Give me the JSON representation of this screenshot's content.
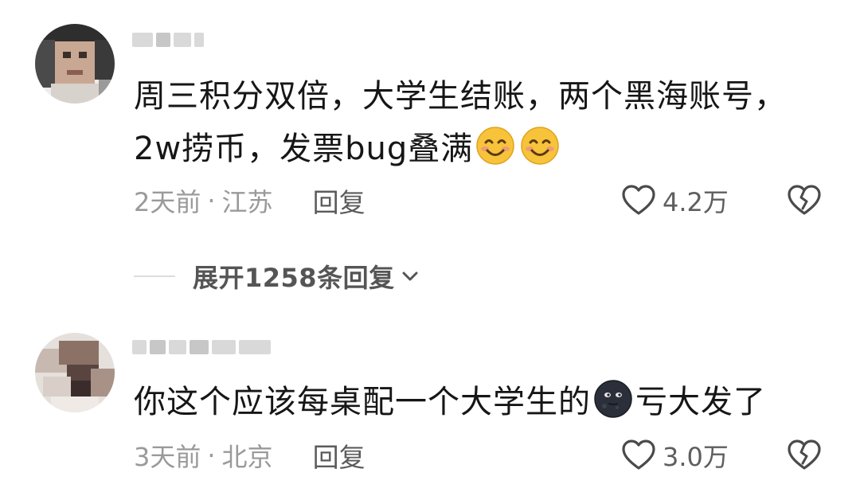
{
  "comments": [
    {
      "text_line1": "周三积分双倍，大学生结账，两个黑海账号，",
      "text_line2_prefix": "2w捞币，发票bug叠满",
      "emojis": [
        "smiling-face-emoji",
        "smiling-face-emoji"
      ],
      "time": "2天前",
      "location": "江苏",
      "separator": "·",
      "reply_label": "回复",
      "likes": "4.2万"
    },
    {
      "text_prefix": "你这个应该每桌配一个大学生的",
      "emoji": "new-moon-face-emoji",
      "text_suffix": "亏大发了",
      "time": "3天前",
      "location": "北京",
      "separator": "·",
      "reply_label": "回复",
      "likes": "3.0万"
    }
  ],
  "expand_replies": {
    "label": "展开1258条回复"
  },
  "icons": {
    "like": "heart-outline-icon",
    "dislike": "broken-heart-icon",
    "expand": "chevron-down-icon"
  },
  "colors": {
    "text": "#161616",
    "meta": "#9a9a9a",
    "reply": "#5b5b5b",
    "emoji_smile": "#f7c33b",
    "emoji_moon": "#2b2f3a"
  }
}
